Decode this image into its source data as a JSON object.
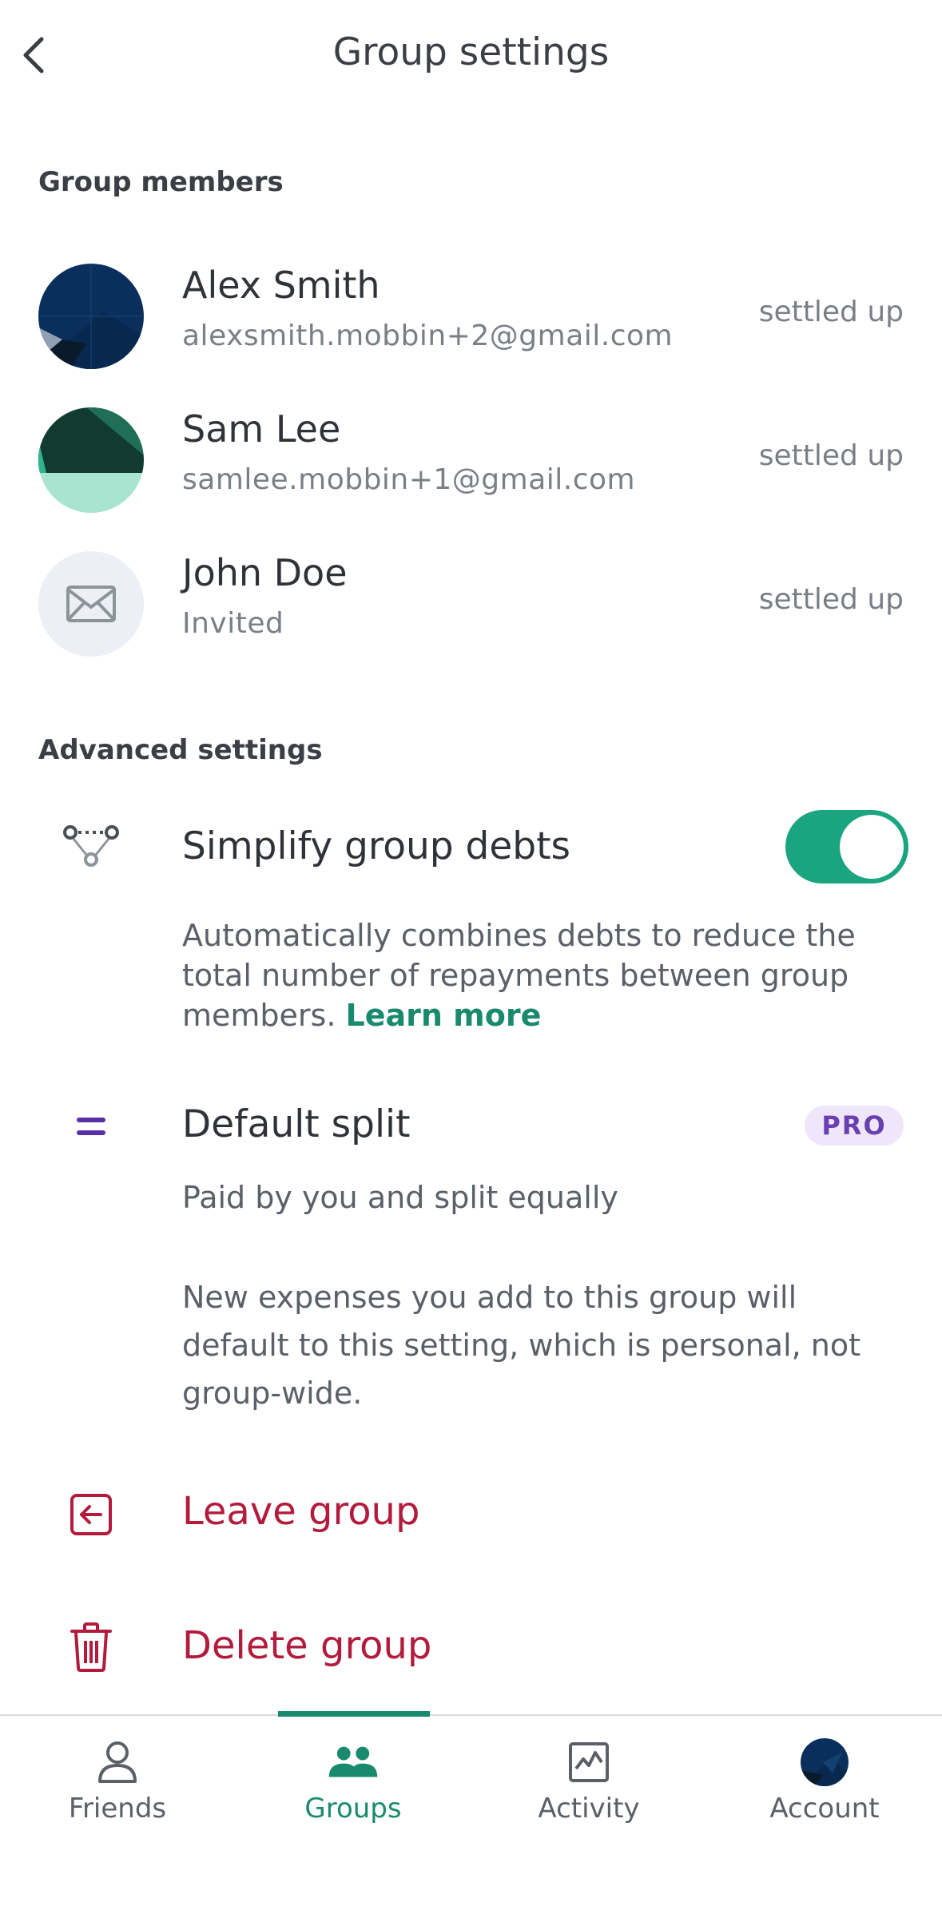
{
  "header": {
    "title": "Group settings"
  },
  "members_section": {
    "label": "Group members",
    "members": [
      {
        "name": "Alex Smith",
        "sub": "alexsmith.mobbin+2@gmail.com",
        "status": "settled up"
      },
      {
        "name": "Sam Lee",
        "sub": "samlee.mobbin+1@gmail.com",
        "status": "settled up"
      },
      {
        "name": "John Doe",
        "sub": "Invited",
        "status": "settled up"
      }
    ]
  },
  "advanced": {
    "label": "Advanced settings",
    "simplify": {
      "title": "Simplify group debts",
      "enabled": true,
      "description": "Automatically combines debts to reduce the total number of repayments between group members.",
      "learn_more": "Learn more"
    },
    "default_split": {
      "title": "Default split",
      "badge": "PRO",
      "value": "Paid by you and split equally",
      "note": "New expenses you add to this group will default to this setting, which is personal, not group-wide."
    }
  },
  "actions": {
    "leave": "Leave group",
    "delete": "Delete group"
  },
  "tabbar": {
    "items": [
      {
        "label": "Friends"
      },
      {
        "label": "Groups"
      },
      {
        "label": "Activity"
      },
      {
        "label": "Account"
      }
    ],
    "active": "Groups"
  },
  "colors": {
    "accent": "#1a8a6e",
    "toggle_on": "#1aa47f",
    "danger": "#b31b3c",
    "pro_text": "#6a3fb0",
    "pro_bg": "#efe6fb"
  }
}
